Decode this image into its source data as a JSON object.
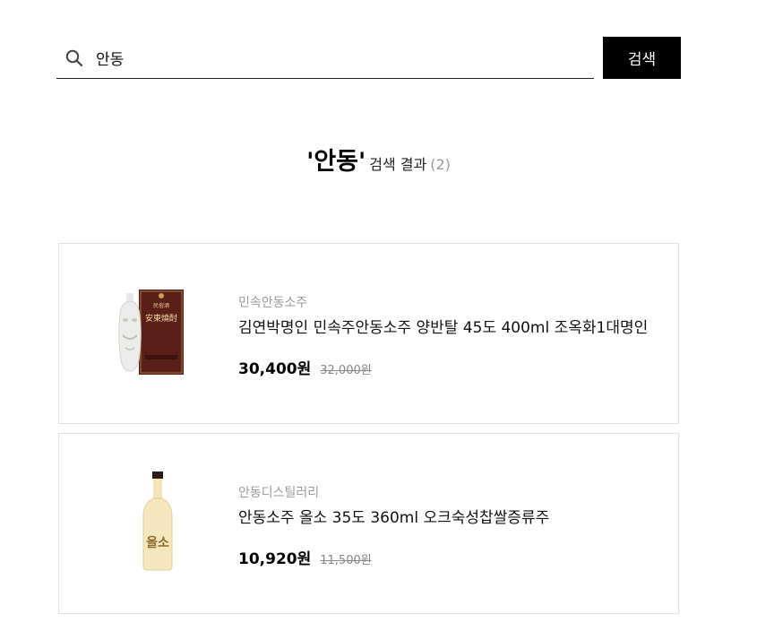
{
  "search": {
    "value": "안동",
    "button_label": "검색"
  },
  "results": {
    "keyword": "'안동'",
    "suffix": "검색 결과",
    "count": "(2)"
  },
  "products": [
    {
      "brand": "민속안동소주",
      "name": "김연박명인 민속주안동소주 양반탈 45도 400ml 조옥화1대명인",
      "sale_price": "30,400원",
      "original_price": "32,000원",
      "label_top": "民俗酒",
      "label_main": "安東燒酎"
    },
    {
      "brand": "안동디스틸러리",
      "name": "안동소주 올소 35도 360ml 오크숙성찹쌀증류주",
      "sale_price": "10,920원",
      "original_price": "11,500원",
      "label_main": "올소"
    }
  ]
}
